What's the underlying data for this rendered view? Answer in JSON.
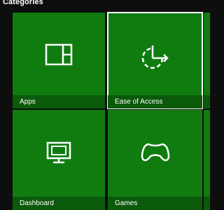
{
  "header": {
    "title": "Categories"
  },
  "tiles": [
    {
      "label": "Apps",
      "icon": "apps-icon"
    },
    {
      "label": "Ease of Access",
      "icon": "ease-of-access-icon",
      "focused": true
    },
    {
      "label": "Dashboard",
      "icon": "dashboard-icon"
    },
    {
      "label": "Games",
      "icon": "controller-icon"
    }
  ],
  "colors": {
    "background": "#0e0e0e",
    "tile": "#107c10",
    "tile_label_bar": "#0b5a0b",
    "focus_border": "#ffffff",
    "text": "#ffffff"
  }
}
